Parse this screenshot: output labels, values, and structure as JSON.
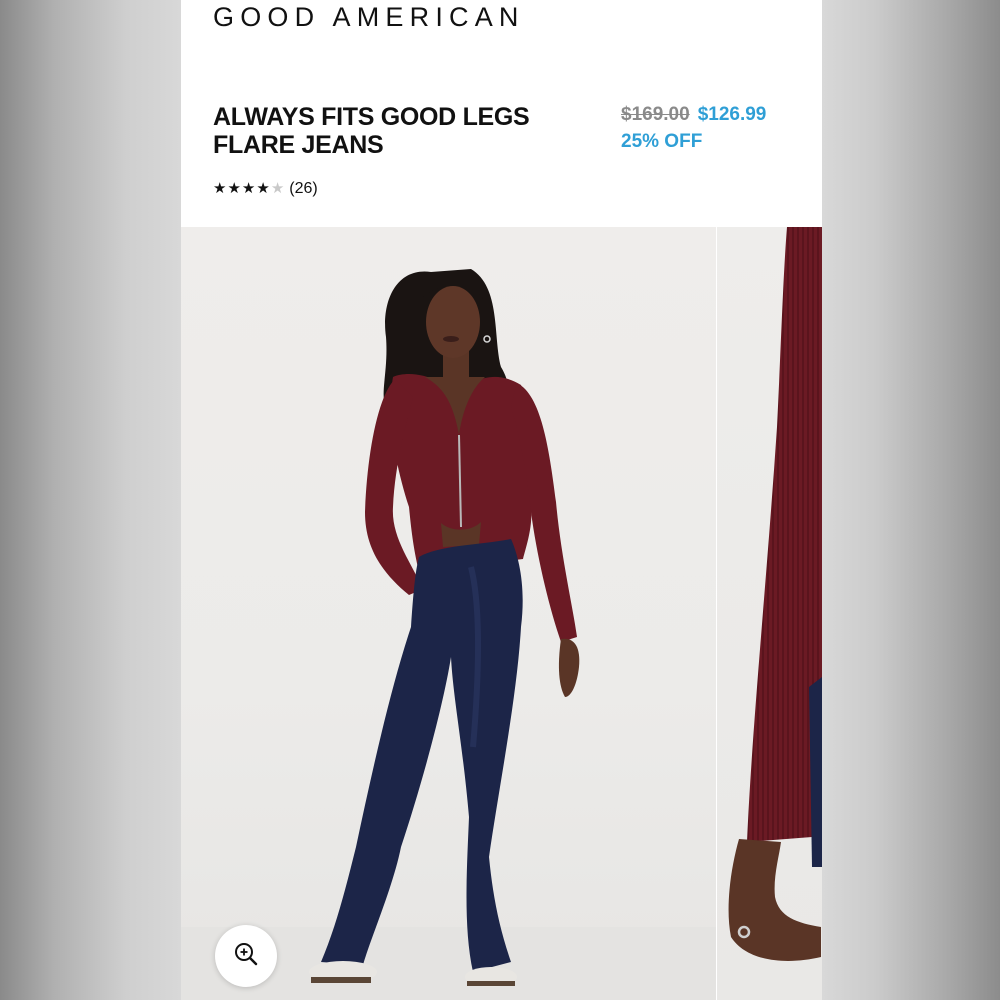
{
  "header": {
    "brand": "GOOD AMERICAN"
  },
  "product": {
    "title": "ALWAYS FITS GOOD LEGS\nFLARE JEANS",
    "original_price": "$169.00",
    "sale_price": "$126.99",
    "discount": "25% OFF",
    "rating": {
      "stars_filled": 4,
      "stars_total": 5,
      "review_count": "(26)"
    }
  },
  "gallery": {
    "zoom_icon": "zoom-in-icon",
    "images": [
      "model-full-body-photo",
      "sleeve-closeup-photo"
    ]
  },
  "colors": {
    "sale": "#2f9fd6",
    "strike": "#8a8a8a",
    "cardigan": "#6b1a24",
    "denim": "#1c2548"
  }
}
